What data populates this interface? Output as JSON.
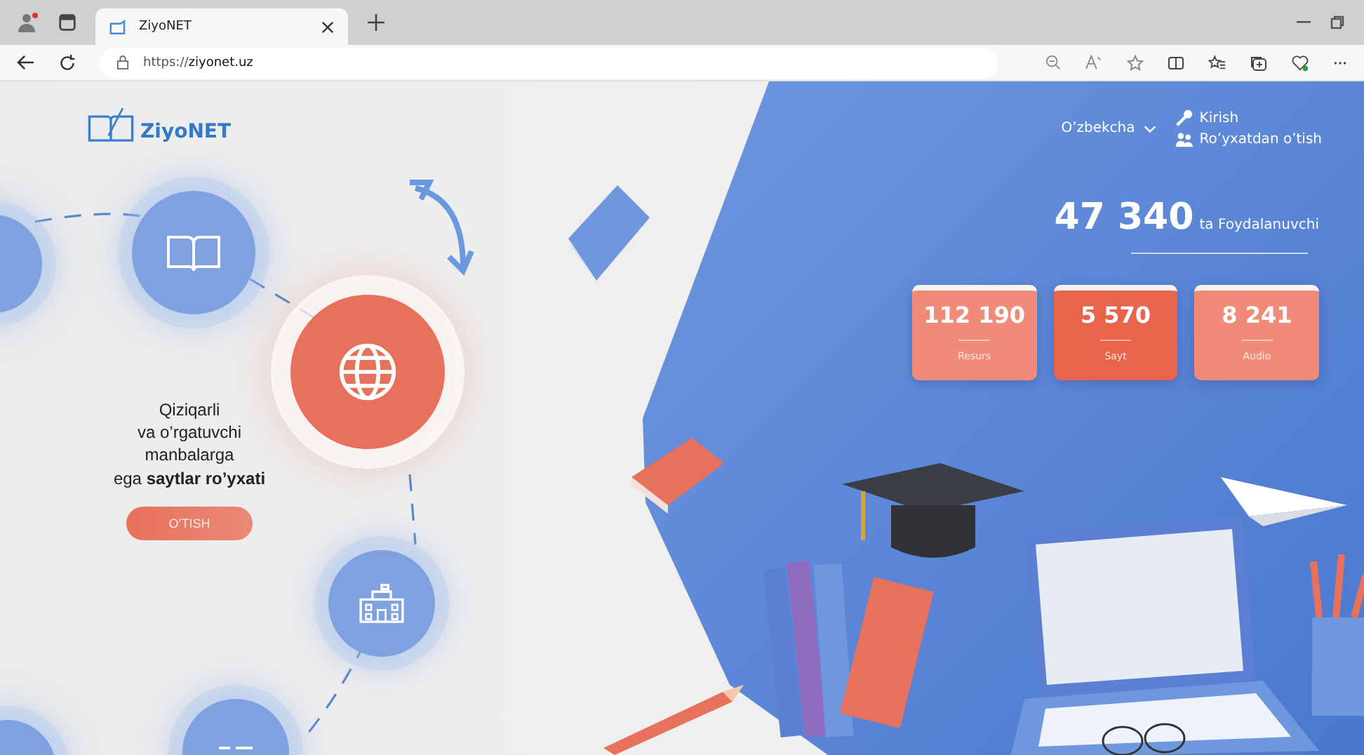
{
  "browser": {
    "tab_title": "ZiyoNET",
    "url_scheme": "https://",
    "url_host": "ziyonet.uz"
  },
  "header": {
    "logo_text": "ZiyoNET",
    "language": "O’zbekcha",
    "login": "Kirish",
    "register": "Ro’yxatdan o’tish"
  },
  "users": {
    "count": "47 340",
    "label": "ta Foydalanuvchi"
  },
  "stats": [
    {
      "value": "112 190",
      "label": "Resurs",
      "selected": false
    },
    {
      "value": "5 570",
      "label": "Sayt",
      "selected": true
    },
    {
      "value": "8 241",
      "label": "Audio",
      "selected": false
    }
  ],
  "promo": {
    "text": "Qiziqarli\nva o’rgatuvchi\nmanbalarga\nega **saytlar ro’yxati**",
    "button": "O’TISH"
  }
}
